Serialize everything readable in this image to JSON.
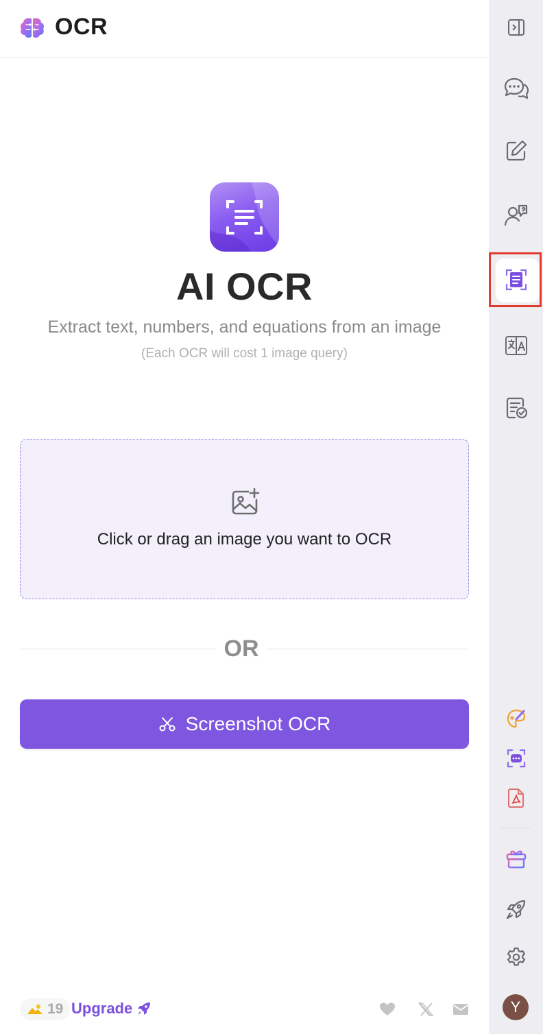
{
  "header": {
    "title": "OCR",
    "logo_icon": "brain-logo-icon"
  },
  "hero": {
    "icon": "ocr-scan-icon",
    "title": "AI OCR",
    "subtitle": "Extract text, numbers, and equations from an image",
    "note": "(Each OCR will cost 1 image query)"
  },
  "dropzone": {
    "icon": "image-add-icon",
    "text": "Click or drag an image you want to OCR"
  },
  "divider": {
    "text": "OR"
  },
  "screenshot_button": {
    "label": "Screenshot OCR",
    "icon": "scissors-icon"
  },
  "footer": {
    "credits_icon": "image-credit-icon",
    "credits_count": "19",
    "upgrade_label": "Upgrade",
    "upgrade_icon": "rocket-icon",
    "links": [
      "heart-icon",
      "x-logo-icon",
      "mail-icon"
    ]
  },
  "sidebar": {
    "items": [
      "sidebar-toggle-icon",
      "chat-icon",
      "edit-icon",
      "ask-people-icon",
      "ocr-icon",
      "translate-icon",
      "checklist-icon"
    ],
    "tools": [
      "paint-icon",
      "screen-chat-icon",
      "pdf-icon"
    ],
    "bottom": [
      "gift-icon",
      "rocket-icon",
      "settings-icon"
    ],
    "active_item": "ocr-icon",
    "avatar_letter": "Y"
  },
  "colors": {
    "accent": "#7f56e0",
    "dropzone_bg": "#f3f0fc",
    "active_highlight": "#e23b2e",
    "sidebar_bg": "#eeeef2"
  }
}
